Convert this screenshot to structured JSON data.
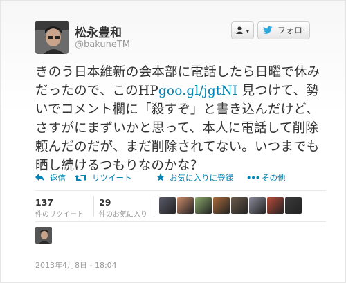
{
  "user": {
    "display_name": "松永豊和",
    "handle": "@bakuneTM"
  },
  "header": {
    "user_menu_label": "▾",
    "follow_label": "フォロー"
  },
  "tweet": {
    "text_before_link": "きのう日本維新の会本部に電話したら日曜で休みだったので、このHP",
    "link_text": "goo.gl/jgtNI",
    "text_after_link": " 見つけて、勢いでコメント欄に「殺すぞ」と書き込んだけど、さすがにまずいかと思って、本人に電話して削除頼んだのだが、まだ削除されてない。いつまでも晒し続けるつもりなのかな？"
  },
  "actions": {
    "reply": "返信",
    "retweet": "リツイート",
    "favorite": "お気に入りに登録",
    "more": "その他"
  },
  "stats": {
    "retweets_count": "137",
    "retweets_label": "件のリツイート",
    "favorites_count": "29",
    "favorites_label": "件のお気に入り"
  },
  "favorited_by_avatar_colors": [
    "#5a5a6a",
    "#c98a6a",
    "#8aa86a",
    "#a86a3a",
    "#6a5a4a",
    "#8a8a9a",
    "#b84a3a",
    "#3a3a3a"
  ],
  "timestamp": "2013年4月8日 - 18:04",
  "icons": {
    "user_menu": "person-icon",
    "follow": "bird-icon",
    "reply": "reply-arrow-icon",
    "retweet": "retweet-icon",
    "favorite": "star-icon",
    "more": "more-dots-icon"
  },
  "colors": {
    "link": "#0084b4",
    "muted": "#999999"
  }
}
